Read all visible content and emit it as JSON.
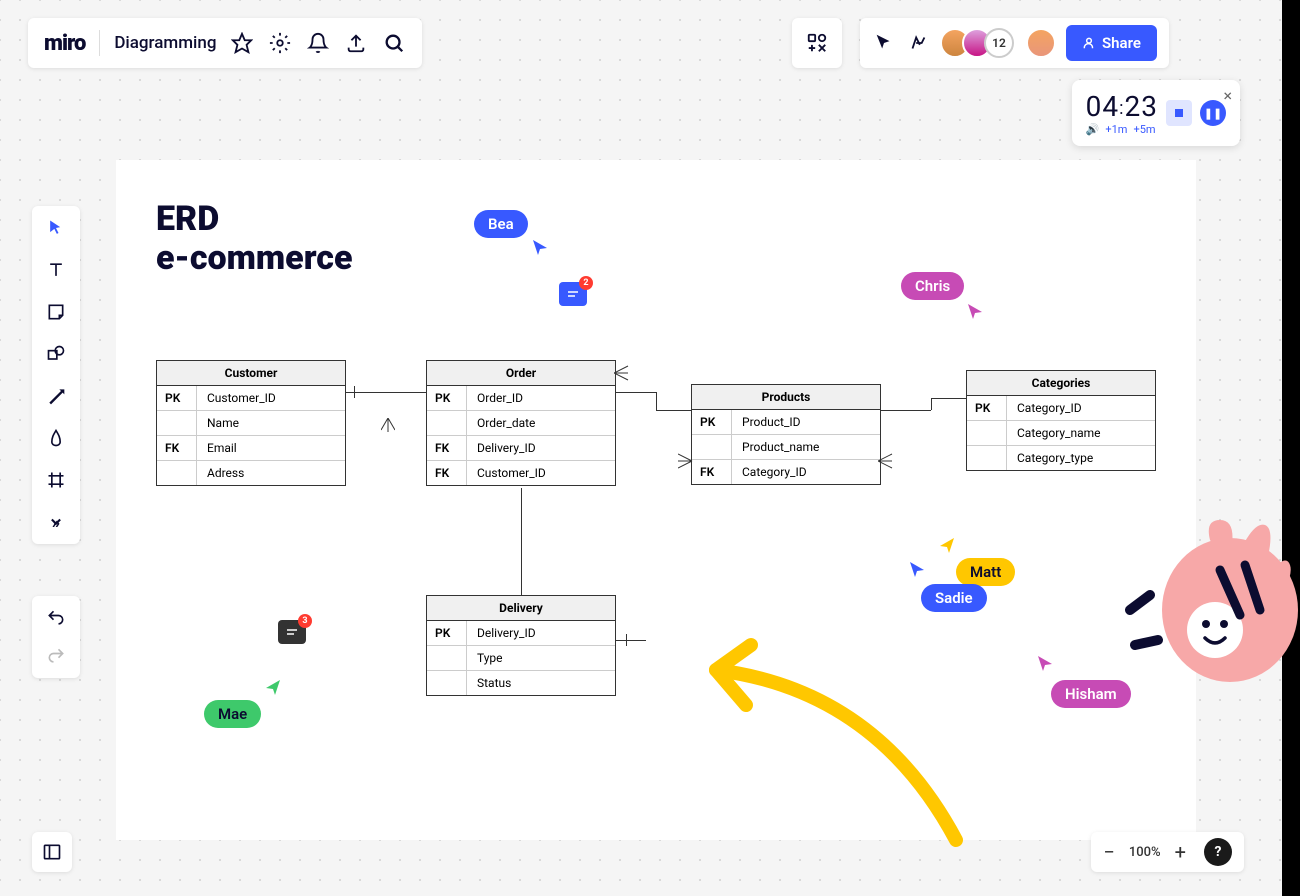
{
  "logo": "miro",
  "board_name": "Diagramming",
  "share_label": "Share",
  "participant_overflow": "12",
  "timer": {
    "value": "04:23",
    "plus1": "+1m",
    "plus5": "+5m"
  },
  "zoom": "100%",
  "help": "?",
  "diagram": {
    "title_line1": "ERD",
    "title_line2": "e-commerce",
    "entities": {
      "customer": {
        "name": "Customer",
        "rows": [
          {
            "key": "PK",
            "field": "Customer_ID"
          },
          {
            "key": "",
            "field": "Name"
          },
          {
            "key": "FK",
            "field": "Email"
          },
          {
            "key": "",
            "field": "Adress"
          }
        ]
      },
      "order": {
        "name": "Order",
        "rows": [
          {
            "key": "PK",
            "field": "Order_ID"
          },
          {
            "key": "",
            "field": "Order_date"
          },
          {
            "key": "FK",
            "field": "Delivery_ID"
          },
          {
            "key": "FK",
            "field": "Customer_ID"
          }
        ]
      },
      "products": {
        "name": "Products",
        "rows": [
          {
            "key": "PK",
            "field": "Product_ID"
          },
          {
            "key": "",
            "field": "Product_name"
          },
          {
            "key": "FK",
            "field": "Category_ID"
          }
        ]
      },
      "categories": {
        "name": "Categories",
        "rows": [
          {
            "key": "PK",
            "field": "Category_ID"
          },
          {
            "key": "",
            "field": "Category_name"
          },
          {
            "key": "",
            "field": "Category_type"
          }
        ]
      },
      "delivery": {
        "name": "Delivery",
        "rows": [
          {
            "key": "PK",
            "field": "Delivery_ID"
          },
          {
            "key": "",
            "field": "Type"
          },
          {
            "key": "",
            "field": "Status"
          }
        ]
      }
    }
  },
  "cursors": {
    "bea": "Bea",
    "chris": "Chris",
    "matt": "Matt",
    "sadie": "Sadie",
    "hisham": "Hisham",
    "mae": "Mae"
  },
  "comments": {
    "c1": "2",
    "c2": "3"
  }
}
